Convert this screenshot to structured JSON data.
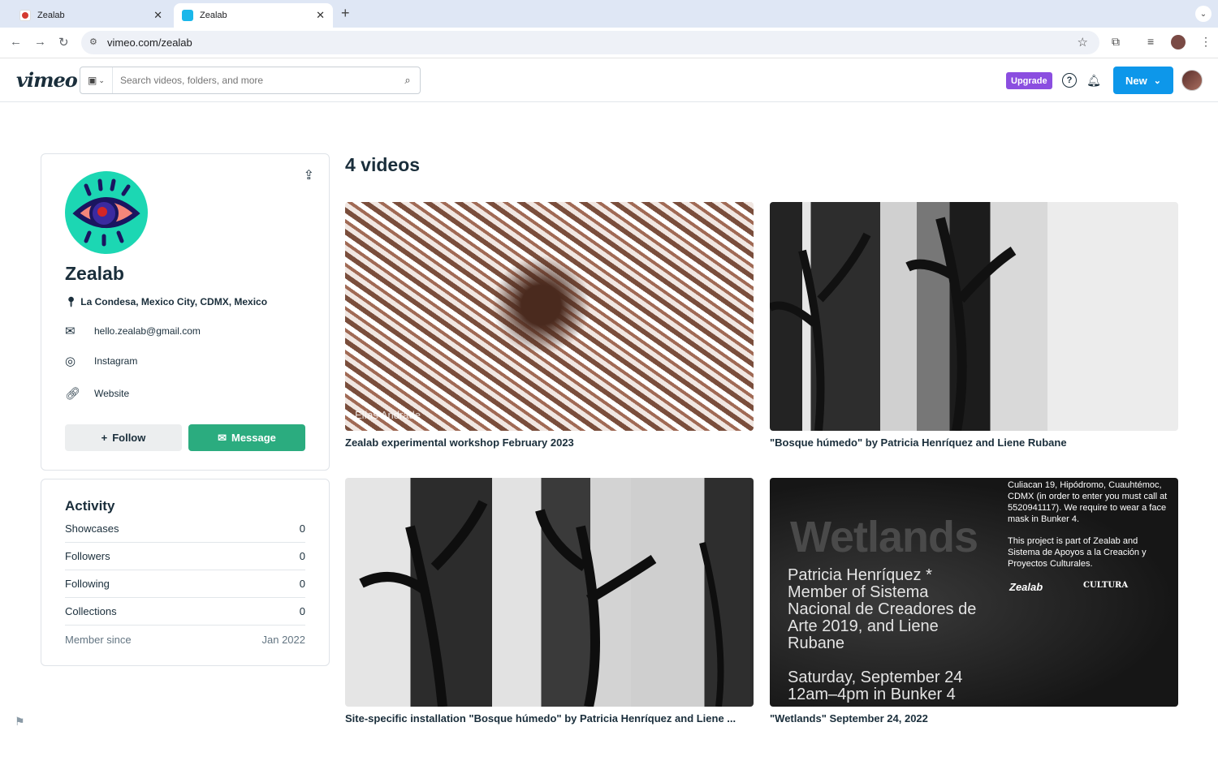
{
  "browser": {
    "tabs": [
      {
        "title": "Zealab",
        "active": false
      },
      {
        "title": "Zealab",
        "active": true
      }
    ],
    "url": "vimeo.com/zealab"
  },
  "header": {
    "logo": "vimeo",
    "search_placeholder": "Search videos, folders, and more",
    "upgrade_label": "Upgrade",
    "new_label": "New"
  },
  "profile": {
    "name": "Zealab",
    "location": "La Condesa, Mexico City, CDMX, Mexico",
    "email": "hello.zealab@gmail.com",
    "instagram": "Instagram",
    "website": "Website",
    "follow_label": "Follow",
    "message_label": "Message"
  },
  "activity": {
    "title": "Activity",
    "rows": [
      {
        "label": "Showcases",
        "value": "0"
      },
      {
        "label": "Followers",
        "value": "0"
      },
      {
        "label": "Following",
        "value": "0"
      },
      {
        "label": "Collections",
        "value": "0"
      },
      {
        "label": "Member since",
        "value": "Jan 2022"
      }
    ]
  },
  "videos": {
    "count_title": "4 videos",
    "items": [
      {
        "title": "Zealab experimental workshop February 2023",
        "watermark": "Elías Andrade"
      },
      {
        "title": "\"Bosque húmedo\" by Patricia Henríquez and Liene Rubane"
      },
      {
        "title": "Site-specific installation \"Bosque húmedo\" by Patricia Henríquez and Liene ..."
      },
      {
        "title": "\"Wetlands\" September 24, 2022"
      }
    ],
    "wetlands_thumb": {
      "big": "Wetlands",
      "info": "Patricia Henríquez * Member of Sistema Nacional de Creadores de Arte 2019, and Liene Rubane",
      "date": "Saturday, September 24 12am–4pm in Bunker 4",
      "address": "Culiacan 19, Hipódromo, Cuauhtémoc, CDMX (in order to enter you must call at 5520941117). We require to wear a face mask in Bunker 4.",
      "project": "This project is part of Zealab and Sistema de Apoyos a la Creación y Proyectos Culturales.",
      "logo1": "Zealab",
      "logo2": "CULTURA"
    }
  }
}
